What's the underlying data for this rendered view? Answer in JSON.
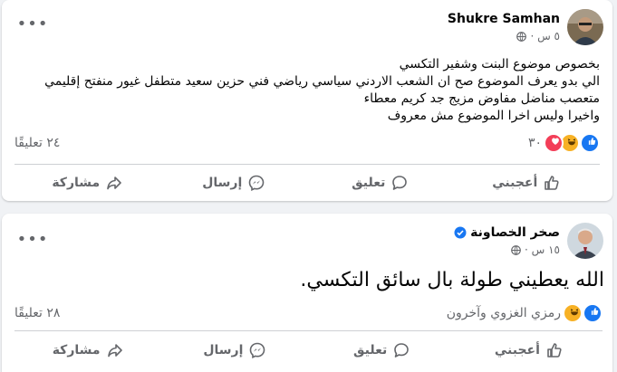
{
  "post1": {
    "author": "Shukre Samhan",
    "time": "٥ س ·",
    "more_label": "•••",
    "lines": [
      "بخصوص موضوع البنت وشفير التكسي",
      "الي بدو يعرف الموضوع صح  ان الشعب الاردني سياسي رياضي فني حزين سعيد متطفل غيور منفتح إقليمي",
      "متعصب مناضل مفاوض مزيج جد كريم معطاء",
      "واخيرا وليس اخرا الموضوع مش معروف"
    ],
    "reaction_count": "٣٠",
    "comments": "٢٤ تعليقًا",
    "actions": {
      "like": "أعجبني",
      "comment": "تعليق",
      "send": "إرسال",
      "share": "مشاركة"
    }
  },
  "post2": {
    "author": "صخر الخصاونة",
    "time": "١٥ س ·",
    "more_label": "•••",
    "text": "الله يعطيني طولة بال سائق التكسي.",
    "reactors": "رمزي الغزوي وآخرون",
    "comments": "٢٨ تعليقًا",
    "actions": {
      "like": "أعجبني",
      "comment": "تعليق",
      "send": "إرسال",
      "share": "مشاركة"
    }
  },
  "colors": {
    "like_blue": "#1877f2",
    "love_red": "#f33e58",
    "haha_yellow": "#f7b125",
    "muted": "#65676b"
  },
  "icons": [
    "globe-icon",
    "like-icon",
    "love-icon",
    "haha-icon",
    "thumbs-up-icon",
    "comment-icon",
    "messenger-icon",
    "share-icon",
    "verified-icon",
    "more-icon"
  ]
}
